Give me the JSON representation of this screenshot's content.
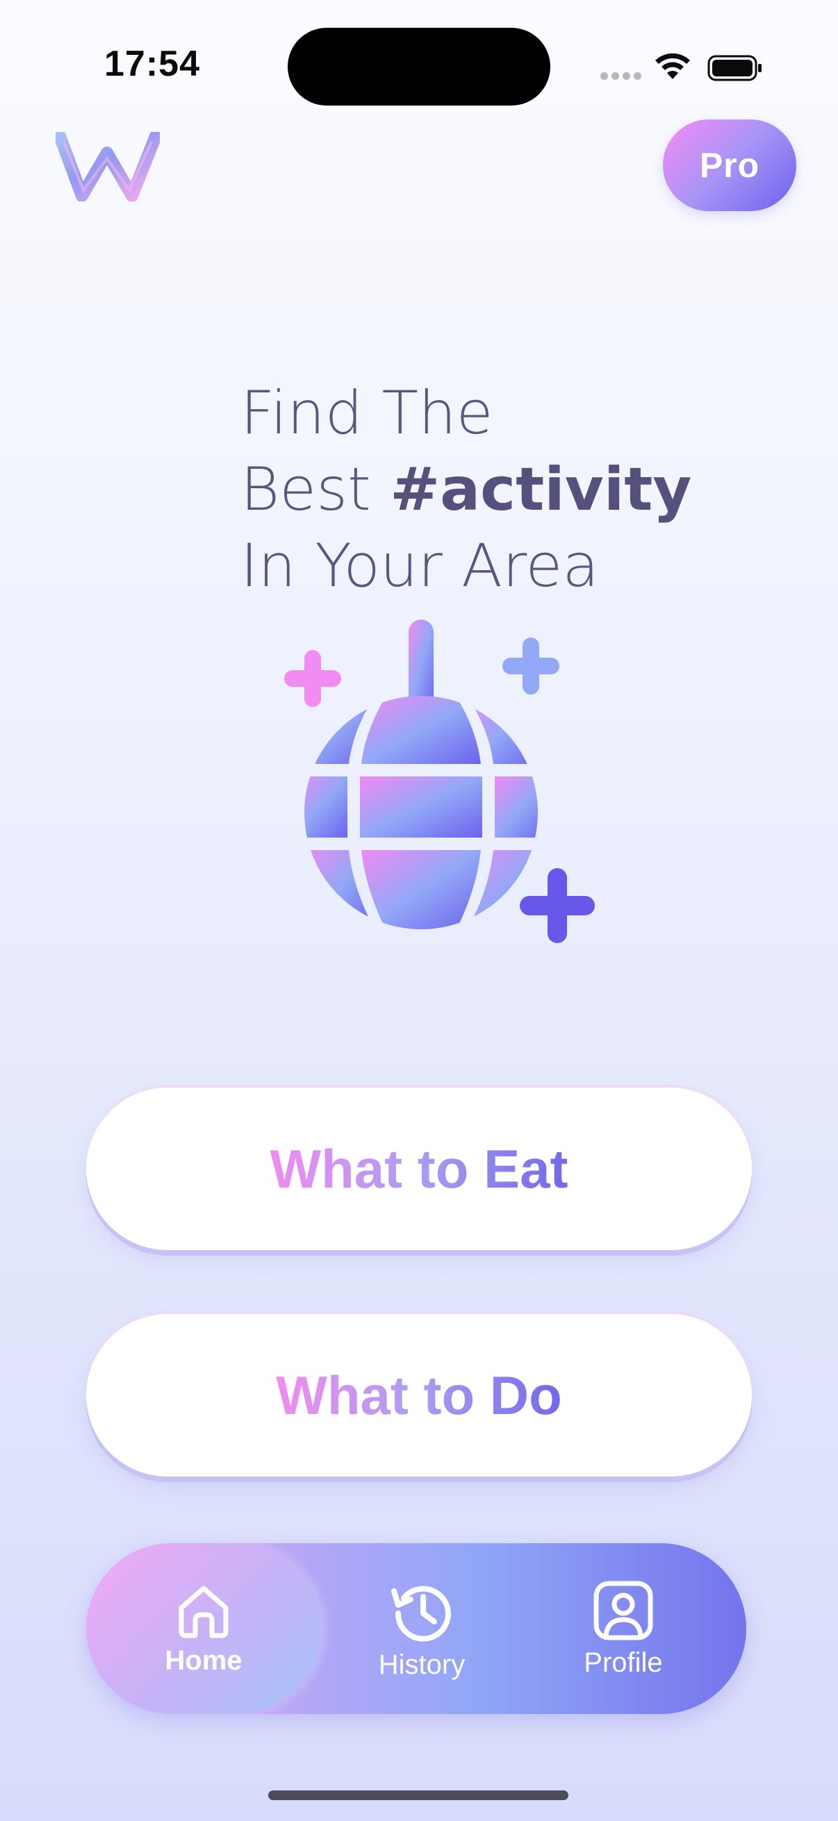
{
  "status_bar": {
    "time": "17:54",
    "icons": [
      "signal-dots-icon",
      "wifi-icon",
      "battery-icon"
    ]
  },
  "header": {
    "logo_icon": "w-logo-icon",
    "pro_label": "Pro"
  },
  "hero": {
    "line1": "Find The",
    "line2_prefix": "Best ",
    "line2_hashtag": "#activity",
    "line3": "In Your Area",
    "illustration_icon": "disco-ball-sparkles-icon"
  },
  "actions": {
    "eat_prefix": "What to ",
    "eat_word": "Eat",
    "do_prefix": "What to ",
    "do_word": "Do"
  },
  "tab_bar": {
    "selected": "Home",
    "items": [
      {
        "label": "Home",
        "icon": "home-icon"
      },
      {
        "label": "History",
        "icon": "history-icon"
      },
      {
        "label": "Profile",
        "icon": "profile-icon"
      }
    ]
  },
  "colors": {
    "accent_pink": "#f08cf0",
    "accent_lavender": "#a99df4",
    "accent_indigo": "#6a62ee",
    "hero_text": "#5a5580"
  }
}
